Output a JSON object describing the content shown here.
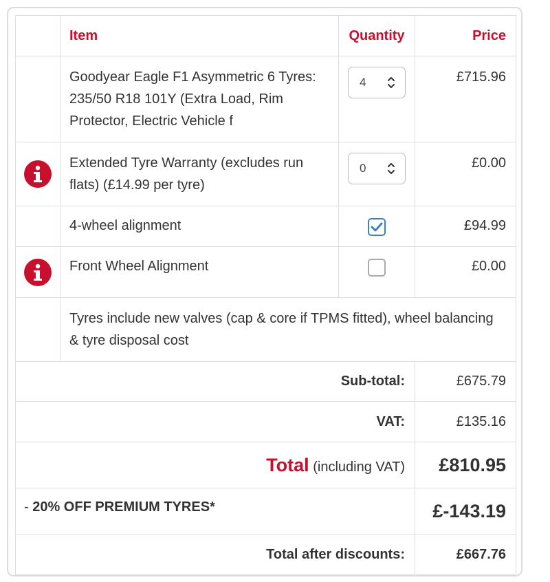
{
  "headers": {
    "item": "Item",
    "quantity": "Quantity",
    "price": "Price"
  },
  "rows": [
    {
      "description": "Goodyear Eagle F1 Asymmetric 6 Tyres: 235/50 R18 101Y (Extra Load, Rim Protector, Electric Vehicle f",
      "quantity": "4",
      "price": "£715.96",
      "icon": ""
    },
    {
      "description": "Extended Tyre Warranty (excludes run flats) (£14.99 per tyre)",
      "quantity": "0",
      "price": "£0.00",
      "icon": "info-icon"
    },
    {
      "description": "4-wheel alignment",
      "checked": true,
      "price": "£94.99",
      "icon": ""
    },
    {
      "description": "Front Wheel Alignment",
      "checked": false,
      "price": "£0.00",
      "icon": "info-icon"
    }
  ],
  "note": "Tyres include new valves (cap & core if TPMS fitted), wheel balancing & tyre disposal cost",
  "summary": {
    "subtotal_label": "Sub-total:",
    "subtotal": "£675.79",
    "vat_label": "VAT:",
    "vat": "£135.16",
    "total_word": "Total",
    "total_note": "(including VAT)",
    "total": "£810.95",
    "discount_prefix": "- ",
    "discount_label": "20% OFF PREMIUM TYRES*",
    "discount": "£-143.19",
    "after_label": "Total after discounts:",
    "after": "£667.76"
  },
  "colors": {
    "accent": "#c8102e",
    "check": "#3b82c4",
    "border": "#dedede"
  }
}
